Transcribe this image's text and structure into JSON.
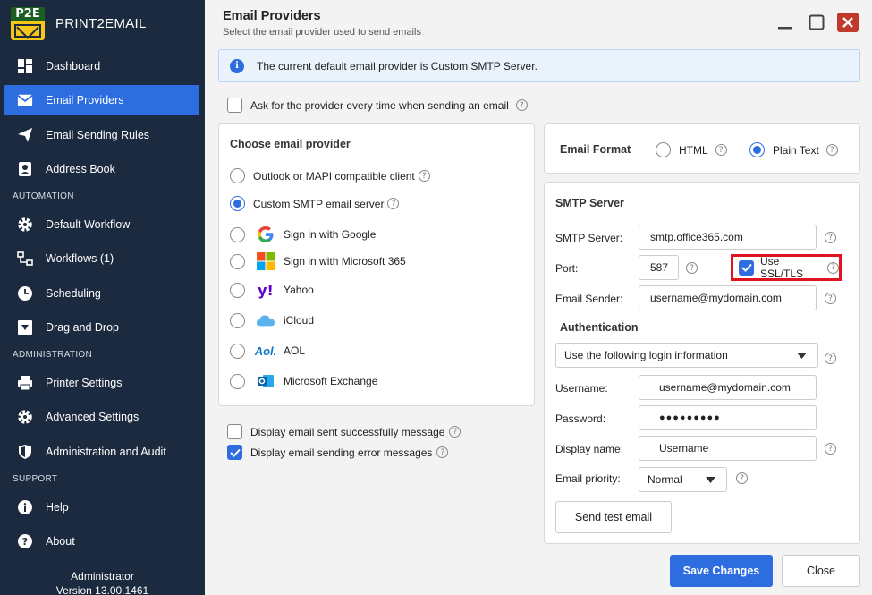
{
  "app": {
    "logo_text": "P2E",
    "name": "PRINT2EMAIL"
  },
  "sidebar": {
    "items": [
      {
        "label": "Dashboard"
      },
      {
        "label": "Email Providers"
      },
      {
        "label": "Email Sending Rules"
      },
      {
        "label": "Address Book"
      }
    ],
    "sections": {
      "automation": {
        "label": "AUTOMATION",
        "items": [
          {
            "label": "Default Workflow"
          },
          {
            "label": "Workflows (1)"
          },
          {
            "label": "Scheduling"
          },
          {
            "label": "Drag and Drop"
          }
        ]
      },
      "administration": {
        "label": "ADMINISTRATION",
        "items": [
          {
            "label": "Printer Settings"
          },
          {
            "label": "Advanced Settings"
          },
          {
            "label": "Administration and Audit"
          }
        ]
      },
      "support": {
        "label": "SUPPORT",
        "items": [
          {
            "label": "Help"
          },
          {
            "label": "About"
          }
        ]
      }
    },
    "user": {
      "name": "Administrator",
      "version": "Version 13.00.1461"
    }
  },
  "page": {
    "title": "Email Providers",
    "subtitle": "Select the email provider used to send emails",
    "info": "The current default email provider is Custom SMTP Server.",
    "ask_provider": "Ask for the provider every time when sending an email",
    "display_success": "Display email sent successfully message",
    "display_error": "Display email sending error messages"
  },
  "providers": {
    "title": "Choose email provider",
    "items": [
      {
        "label": "Outlook or MAPI compatible client"
      },
      {
        "label": "Custom SMTP email server"
      },
      {
        "label": "Sign in with Google"
      },
      {
        "label": "Sign in with Microsoft 365"
      },
      {
        "label": "Yahoo"
      },
      {
        "label": "iCloud"
      },
      {
        "label": "AOL"
      },
      {
        "label": "Microsoft Exchange"
      }
    ],
    "selected": "Custom SMTP email server",
    "yahoo_logo": "y!",
    "aol_logo": "Aol."
  },
  "format": {
    "label": "Email Format",
    "html": "HTML",
    "plain": "Plain Text",
    "selected": "Plain Text"
  },
  "smtp": {
    "title": "SMTP Server",
    "server_label": "SMTP Server:",
    "server": "smtp.office365.com",
    "port_label": "Port:",
    "port": "587",
    "ssl_label": "Use SSL/TLS",
    "ssl_checked": true,
    "sender_label": "Email Sender:",
    "sender": "username@mydomain.com",
    "auth_title": "Authentication",
    "auth_mode": "Use the following login information",
    "username_label": "Username:",
    "username": "username@mydomain.com",
    "password_label": "Password:",
    "password": "●●●●●●●●●",
    "display_name_label": "Display name:",
    "display_name": "Username",
    "priority_label": "Email priority:",
    "priority": "Normal",
    "test_button": "Send test email"
  },
  "actions": {
    "save": "Save Changes",
    "close": "Close"
  },
  "colors": {
    "sidebar": "#1b2a3e",
    "accent": "#2d6de0",
    "highlight": "#e0141e",
    "close_button": "#c0392b"
  },
  "icons": [
    "dashboard-icon",
    "envelope-icon",
    "send-icon",
    "address-book-icon",
    "gear-icon",
    "workflow-icon",
    "clock-icon",
    "drag-drop-icon",
    "printer-icon",
    "shield-icon",
    "help-icon",
    "info-icon",
    "minimize-icon",
    "maximize-icon",
    "close-icon"
  ]
}
